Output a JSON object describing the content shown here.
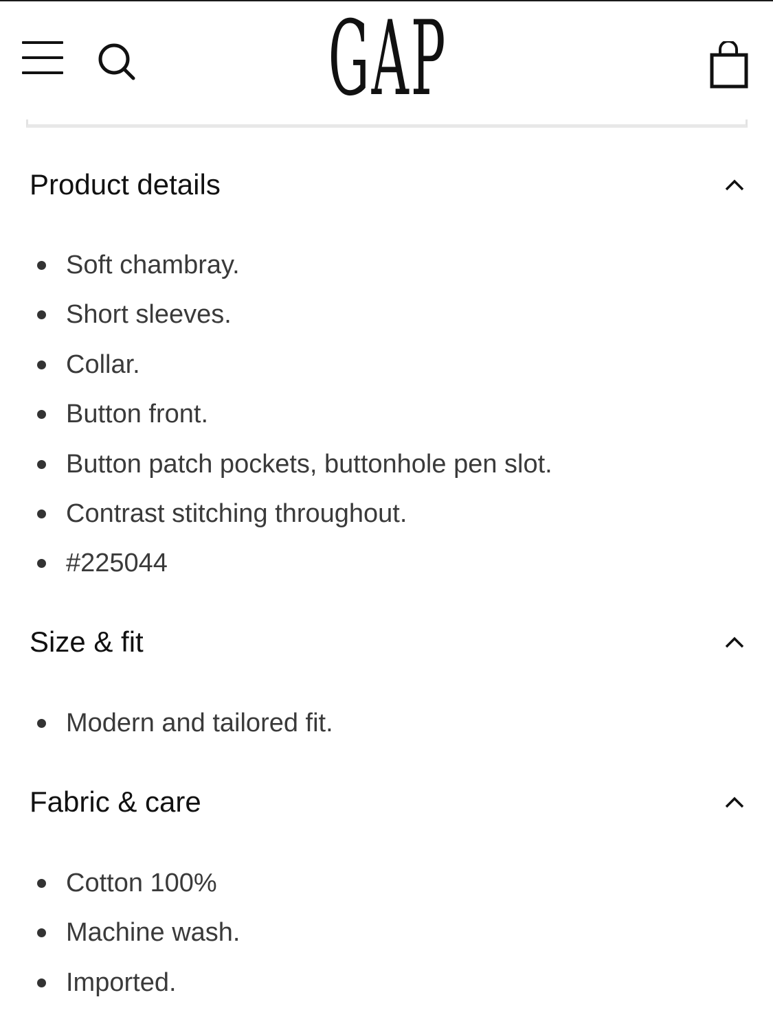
{
  "header": {
    "logo_text": "GAP",
    "menu_icon": "hamburger-menu-icon",
    "search_icon": "search-icon",
    "bag_icon": "shopping-bag-icon"
  },
  "sections": [
    {
      "title": "Product details",
      "expanded": true,
      "items": [
        "Soft chambray.",
        "Short sleeves.",
        "Collar.",
        "Button front.",
        "Button patch pockets, buttonhole pen slot.",
        "Contrast stitching throughout.",
        "#225044"
      ]
    },
    {
      "title": "Size & fit",
      "expanded": true,
      "items": [
        "Modern and tailored fit."
      ]
    },
    {
      "title": "Fabric & care",
      "expanded": true,
      "items": [
        "Cotton 100%",
        "Machine wash.",
        "Imported."
      ]
    }
  ],
  "colors": {
    "text_primary": "#111111",
    "text_secondary": "#3a3a3a",
    "divider": "#e8e8e8"
  }
}
